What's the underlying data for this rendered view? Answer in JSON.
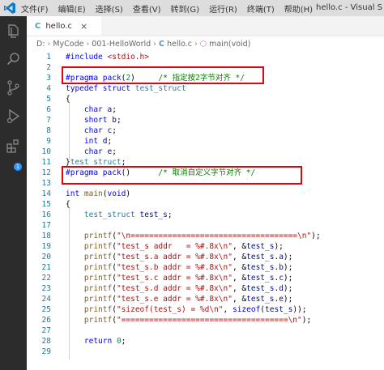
{
  "menu": {
    "items": [
      "文件(F)",
      "编辑(E)",
      "选择(S)",
      "查看(V)",
      "转到(G)",
      "运行(R)",
      "终端(T)",
      "帮助(H)"
    ],
    "window_title": "hello.c - Visual S"
  },
  "activity_bar": {
    "icons": [
      "explorer-icon",
      "search-icon",
      "source-control-icon",
      "run-debug-icon",
      "extensions-icon"
    ],
    "extensions_badge": "1"
  },
  "tab": {
    "icon": "C",
    "label": "hello.c",
    "close": "×"
  },
  "breadcrumb": {
    "drive": "D:",
    "folder1": "MyCode",
    "folder2": "001-HelloWorld",
    "file_icon": "C",
    "file": "hello.c",
    "fn_icon": "⬡",
    "function": "main(void)"
  },
  "editor": {
    "lines": [
      {
        "n": "1",
        "t": [
          [
            "pp",
            "#include "
          ],
          [
            "str",
            "<stdio.h>"
          ]
        ]
      },
      {
        "n": "2",
        "t": []
      },
      {
        "n": "3",
        "t": [
          [
            "pp",
            "#pragma pack"
          ],
          [
            "",
            "("
          ],
          [
            "num",
            "2"
          ],
          [
            "",
            ")"
          ],
          [
            "",
            "     "
          ],
          [
            "cmt",
            "/* 指定按2字节对齐 */"
          ]
        ]
      },
      {
        "n": "4",
        "t": [
          [
            "kw",
            "typedef struct "
          ],
          [
            "typ",
            "test_struct"
          ]
        ]
      },
      {
        "n": "5",
        "t": [
          [
            "",
            "{"
          ]
        ]
      },
      {
        "n": "6",
        "t": [
          [
            "",
            "    "
          ],
          [
            "kw",
            "char "
          ],
          [
            "var",
            "a"
          ],
          [
            "",
            ";"
          ]
        ]
      },
      {
        "n": "7",
        "t": [
          [
            "",
            "    "
          ],
          [
            "kw",
            "short "
          ],
          [
            "var",
            "b"
          ],
          [
            "",
            ";"
          ]
        ]
      },
      {
        "n": "8",
        "t": [
          [
            "",
            "    "
          ],
          [
            "kw",
            "char "
          ],
          [
            "var",
            "c"
          ],
          [
            "",
            ";"
          ]
        ]
      },
      {
        "n": "9",
        "t": [
          [
            "",
            "    "
          ],
          [
            "kw",
            "int "
          ],
          [
            "var",
            "d"
          ],
          [
            "",
            ";"
          ]
        ]
      },
      {
        "n": "10",
        "t": [
          [
            "",
            "    "
          ],
          [
            "kw",
            "char "
          ],
          [
            "var",
            "e"
          ],
          [
            "",
            ";"
          ]
        ]
      },
      {
        "n": "11",
        "t": [
          [
            "",
            "}"
          ],
          [
            "typ",
            "test_struct"
          ],
          [
            "",
            ";"
          ]
        ]
      },
      {
        "n": "12",
        "t": [
          [
            "pp",
            "#pragma pack"
          ],
          [
            "",
            "()"
          ],
          [
            "",
            "      "
          ],
          [
            "cmt",
            "/* 取消自定义字节对齐 */"
          ]
        ]
      },
      {
        "n": "13",
        "t": []
      },
      {
        "n": "14",
        "t": [
          [
            "kw",
            "int "
          ],
          [
            "fn",
            "main"
          ],
          [
            "",
            "("
          ],
          [
            "kw",
            "void"
          ],
          [
            "",
            ")"
          ]
        ]
      },
      {
        "n": "15",
        "t": [
          [
            "",
            "{"
          ]
        ]
      },
      {
        "n": "16",
        "t": [
          [
            "",
            "    "
          ],
          [
            "typ",
            "test_struct "
          ],
          [
            "var",
            "test_s"
          ],
          [
            "",
            ";"
          ]
        ]
      },
      {
        "n": "17",
        "t": []
      },
      {
        "n": "18",
        "t": [
          [
            "",
            "    "
          ],
          [
            "fn",
            "printf"
          ],
          [
            "",
            "("
          ],
          [
            "str",
            "\"\\n====================================\\n\""
          ],
          [
            "",
            ");"
          ]
        ]
      },
      {
        "n": "19",
        "t": [
          [
            "",
            "    "
          ],
          [
            "fn",
            "printf"
          ],
          [
            "",
            "("
          ],
          [
            "str",
            "\"test_s addr   = %#.8x\\n\""
          ],
          [
            "",
            ", &"
          ],
          [
            "var",
            "test_s"
          ],
          [
            "",
            ");"
          ]
        ]
      },
      {
        "n": "20",
        "t": [
          [
            "",
            "    "
          ],
          [
            "fn",
            "printf"
          ],
          [
            "",
            "("
          ],
          [
            "str",
            "\"test_s.a addr = %#.8x\\n\""
          ],
          [
            "",
            ", &"
          ],
          [
            "var",
            "test_s"
          ],
          [
            "",
            "."
          ],
          [
            "var",
            "a"
          ],
          [
            "",
            ");"
          ]
        ]
      },
      {
        "n": "21",
        "t": [
          [
            "",
            "    "
          ],
          [
            "fn",
            "printf"
          ],
          [
            "",
            "("
          ],
          [
            "str",
            "\"test_s.b addr = %#.8x\\n\""
          ],
          [
            "",
            ", &"
          ],
          [
            "var",
            "test_s"
          ],
          [
            "",
            "."
          ],
          [
            "var",
            "b"
          ],
          [
            "",
            ");"
          ]
        ]
      },
      {
        "n": "22",
        "t": [
          [
            "",
            "    "
          ],
          [
            "fn",
            "printf"
          ],
          [
            "",
            "("
          ],
          [
            "str",
            "\"test_s.c addr = %#.8x\\n\""
          ],
          [
            "",
            ", &"
          ],
          [
            "var",
            "test_s"
          ],
          [
            "",
            "."
          ],
          [
            "var",
            "c"
          ],
          [
            "",
            ");"
          ]
        ]
      },
      {
        "n": "23",
        "t": [
          [
            "",
            "    "
          ],
          [
            "fn",
            "printf"
          ],
          [
            "",
            "("
          ],
          [
            "str",
            "\"test_s.d addr = %#.8x\\n\""
          ],
          [
            "",
            ", &"
          ],
          [
            "var",
            "test_s"
          ],
          [
            "",
            "."
          ],
          [
            "var",
            "d"
          ],
          [
            "",
            ");"
          ]
        ]
      },
      {
        "n": "24",
        "t": [
          [
            "",
            "    "
          ],
          [
            "fn",
            "printf"
          ],
          [
            "",
            "("
          ],
          [
            "str",
            "\"test_s.e addr = %#.8x\\n\""
          ],
          [
            "",
            ", &"
          ],
          [
            "var",
            "test_s"
          ],
          [
            "",
            "."
          ],
          [
            "var",
            "e"
          ],
          [
            "",
            ");"
          ]
        ]
      },
      {
        "n": "25",
        "t": [
          [
            "",
            "    "
          ],
          [
            "fn",
            "printf"
          ],
          [
            "",
            "("
          ],
          [
            "str",
            "\"sizeof(test_s) = %d\\n\""
          ],
          [
            "",
            ", "
          ],
          [
            "kw",
            "sizeof"
          ],
          [
            "",
            "("
          ],
          [
            "var",
            "test_s"
          ],
          [
            "",
            "));"
          ]
        ]
      },
      {
        "n": "26",
        "t": [
          [
            "",
            "    "
          ],
          [
            "fn",
            "printf"
          ],
          [
            "",
            "("
          ],
          [
            "str",
            "\"====================================\\n\""
          ],
          [
            "",
            ");"
          ]
        ]
      },
      {
        "n": "27",
        "t": []
      },
      {
        "n": "28",
        "t": [
          [
            "",
            "    "
          ],
          [
            "kw",
            "return "
          ],
          [
            "num",
            "0"
          ],
          [
            "",
            ";"
          ]
        ]
      },
      {
        "n": "29",
        "t": []
      }
    ]
  },
  "colors": {
    "keyword": "#0000ff",
    "string": "#a31515",
    "comment": "#008000",
    "number": "#098658",
    "type": "#267f99",
    "function": "#795e26",
    "variable": "#001080",
    "highlight_box": "#e8000b",
    "line_number": "#237893"
  }
}
